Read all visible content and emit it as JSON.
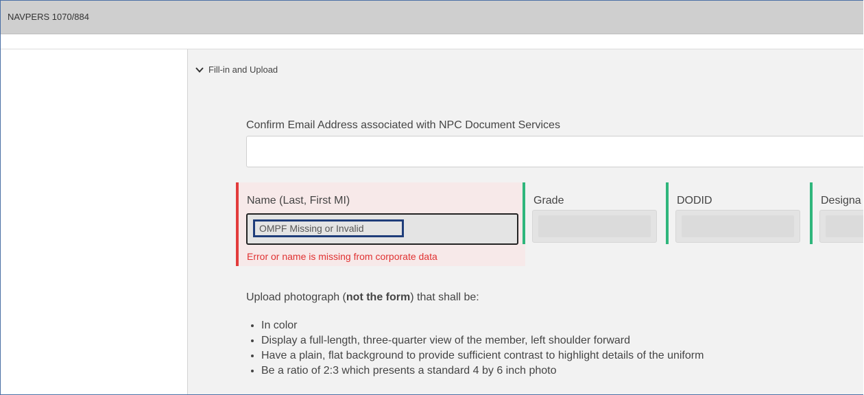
{
  "header": {
    "title": "NAVPERS 1070/884"
  },
  "section": {
    "label": "Fill-in and Upload"
  },
  "email": {
    "label": "Confirm Email Address associated with NPC Document Services",
    "value": ""
  },
  "fields": {
    "name": {
      "label": "Name (Last, First MI)",
      "value": "OMPF Missing or Invalid",
      "error": "Error or name is missing from corporate data"
    },
    "grade": {
      "label": "Grade",
      "value": ""
    },
    "dodid": {
      "label": "DODID",
      "value": ""
    },
    "designator": {
      "label": "Designa",
      "value": ""
    }
  },
  "upload": {
    "intro_prefix": "Upload photograph (",
    "intro_bold": "not the form",
    "intro_suffix": ") that shall be:",
    "requirements": [
      "In color",
      "Display a full-length, three-quarter view of the member, left shoulder forward",
      "Have a plain, flat background to provide sufficient contrast to highlight details of the uniform",
      "Be a ratio of 2:3 which presents a standard 4 by 6 inch photo"
    ]
  },
  "colors": {
    "error_red": "#e23b3b",
    "valid_green": "#2fb67c",
    "highlight_blue": "#1f3d7a",
    "header_gray": "#cfcfcf"
  },
  "icons": {
    "section_toggle": "chevron-down-icon"
  }
}
